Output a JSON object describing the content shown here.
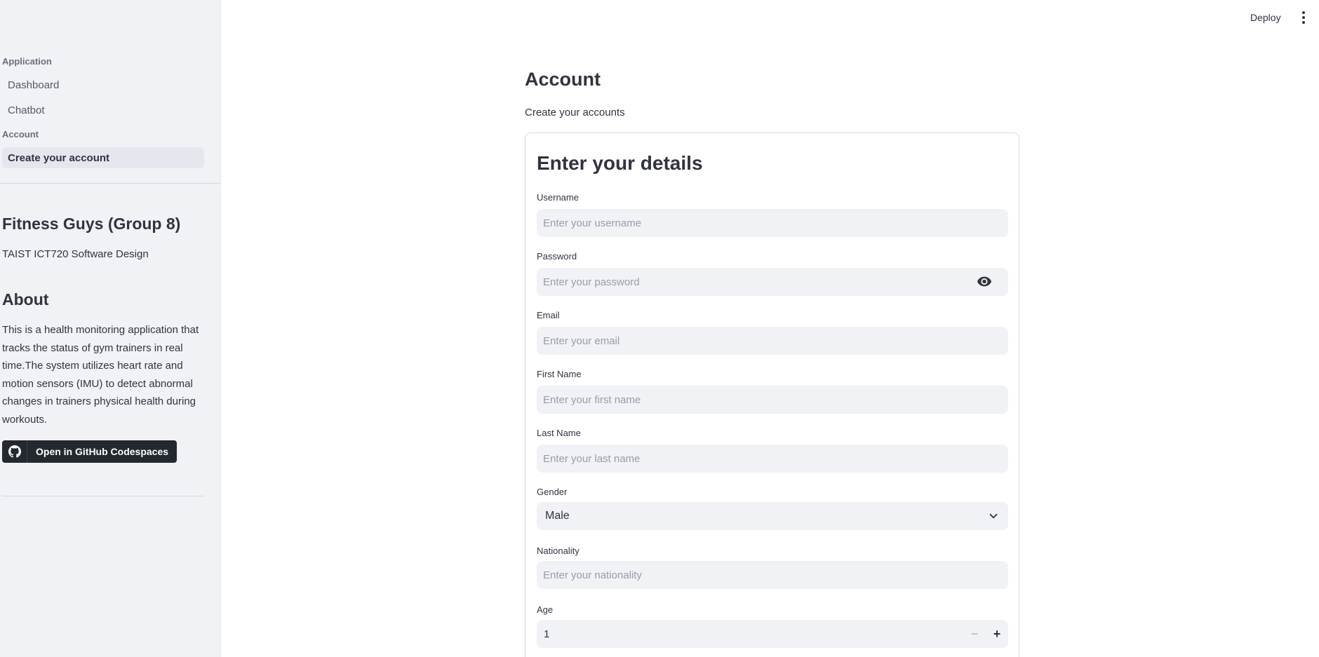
{
  "sidebar": {
    "sections": [
      {
        "label": "Application",
        "items": [
          {
            "label": "Dashboard"
          },
          {
            "label": "Chatbot"
          }
        ]
      },
      {
        "label": "Account",
        "items": [
          {
            "label": "Create your account",
            "active": true
          }
        ]
      }
    ],
    "title": "Fitness Guys (Group 8)",
    "subtitle": "TAIST ICT720 Software Design",
    "about_heading": "About",
    "about_text": "This is a health monitoring application that tracks the status of gym trainers in real time.The system utilizes heart rate and motion sensors (IMU) to detect abnormal changes in trainers physical health during workouts.",
    "codespaces_button": "Open in GitHub Codespaces"
  },
  "header": {
    "deploy_label": "Deploy",
    "menu_icon": "more-vertical-icon"
  },
  "main": {
    "title": "Account",
    "subtitle": "Create your accounts",
    "form": {
      "heading": "Enter your details",
      "username": {
        "label": "Username",
        "placeholder": "Enter your username"
      },
      "password": {
        "label": "Password",
        "placeholder": "Enter your password"
      },
      "email": {
        "label": "Email",
        "placeholder": "Enter your email"
      },
      "first_name": {
        "label": "First Name",
        "placeholder": "Enter your first name"
      },
      "last_name": {
        "label": "Last Name",
        "placeholder": "Enter your last name"
      },
      "gender": {
        "label": "Gender",
        "value": "Male"
      },
      "nationality": {
        "label": "Nationality",
        "placeholder": "Enter your nationality"
      },
      "age": {
        "label": "Age",
        "value": "1",
        "minus": "−",
        "plus": "+"
      }
    }
  },
  "colors": {
    "sidebar_bg": "#f0f2f6",
    "input_bg": "#f0f2f6",
    "text": "#31333f",
    "github_button": "#24292f"
  }
}
